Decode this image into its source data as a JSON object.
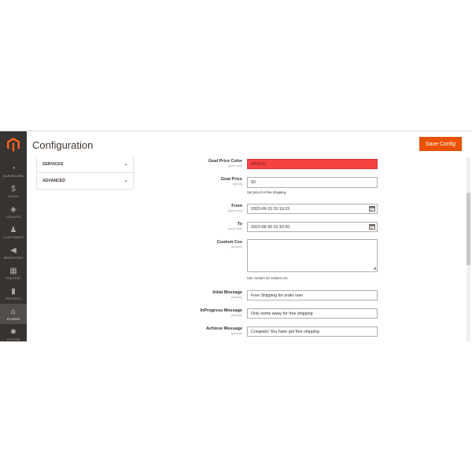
{
  "header": {
    "title": "Configuration",
    "save_label": "Save Config"
  },
  "sidebar": {
    "items": [
      {
        "label": "DASHBOARD",
        "icon": "dashboard-icon",
        "glyph": "◔"
      },
      {
        "label": "SALES",
        "icon": "dollar-icon",
        "glyph": "$"
      },
      {
        "label": "CATALOG",
        "icon": "cube-icon",
        "glyph": "◈"
      },
      {
        "label": "CUSTOMERS",
        "icon": "person-icon",
        "glyph": "♟"
      },
      {
        "label": "MARKETING",
        "icon": "megaphone-icon",
        "glyph": "◀"
      },
      {
        "label": "CONTENT",
        "icon": "content-icon",
        "glyph": "▦"
      },
      {
        "label": "REPORTS",
        "icon": "bar-chart-icon",
        "glyph": "▮"
      },
      {
        "label": "STORES",
        "icon": "store-icon",
        "glyph": "⌂"
      },
      {
        "label": "SYSTEM",
        "icon": "gear-icon",
        "glyph": "✹"
      }
    ]
  },
  "tabs": [
    {
      "label": "SERVICES"
    },
    {
      "label": "ADVANCED"
    }
  ],
  "form": {
    "goal_color": {
      "label": "Goal Price Color",
      "scope": "[store view]",
      "value": "#f54242"
    },
    "goal_price": {
      "label": "Goal Price",
      "scope": "[global]",
      "value": "50",
      "note": "Set price for free shipping."
    },
    "from": {
      "label": "From",
      "scope": "[store view]",
      "value": "2022-06-15 01:10:15"
    },
    "to": {
      "label": "To",
      "scope": "[store view]",
      "value": "2022-06-30 01:10:20"
    },
    "custom_css": {
      "label": "Custom Css",
      "scope": "[website]",
      "value": "",
      "note": "Use custom for custom css"
    },
    "initial_message": {
      "label": "Intial Message",
      "scope": "[website]",
      "value": "Free Shipping for order over"
    },
    "inprogress_message": {
      "label": "InProgress Message",
      "scope": "[website]",
      "value": "Only some away for free shipping"
    },
    "achieve_message": {
      "label": "Achieve Message",
      "scope": "[website]",
      "value": "Congrats! You have got free shipping"
    }
  },
  "colors": {
    "accent": "#eb5202",
    "sidebar": "#373330",
    "goal_color_field": "#f54242"
  }
}
